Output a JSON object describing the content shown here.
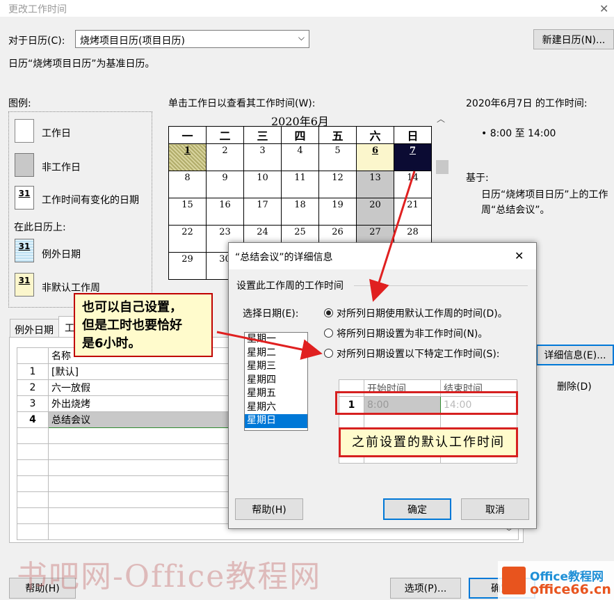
{
  "window": {
    "title": "更改工作时间",
    "close_glyph": "✕"
  },
  "calendar_selector": {
    "label": "对于日历(C):",
    "value": "烧烤项目日历(项目日历)",
    "base_text": "日历“烧烤项目日历”为基准日历。",
    "new_button": "新建日历(N)..."
  },
  "legend": {
    "title": "图例:",
    "items": [
      {
        "swatch": "",
        "label": "工作日"
      },
      {
        "swatch": "",
        "label": "非工作日"
      },
      {
        "swatch": "31",
        "label": "工作时间有变化的日期"
      }
    ],
    "on_calendar_title": "在此日历上:",
    "calendar_items": [
      {
        "swatch": "31",
        "label": "例外日期"
      },
      {
        "swatch": "31",
        "label": "非默认工作周"
      }
    ]
  },
  "month_view": {
    "instruction": "单击工作日以查看其工作时间(W):",
    "month": "2020年6月",
    "weekdays": [
      "一",
      "二",
      "三",
      "四",
      "五",
      "六",
      "日"
    ],
    "rows": [
      [
        "1",
        "2",
        "3",
        "4",
        "5",
        "6",
        "7"
      ],
      [
        "8",
        "9",
        "10",
        "11",
        "12",
        "13",
        "14"
      ],
      [
        "15",
        "16",
        "17",
        "18",
        "19",
        "20",
        "21"
      ],
      [
        "22",
        "23",
        "24",
        "25",
        "26",
        "27",
        "28"
      ],
      [
        "29",
        "30",
        "",
        "",
        "",
        "",
        ""
      ],
      [
        "",
        "",
        "",
        "",
        "",
        "",
        ""
      ]
    ]
  },
  "work_time": {
    "heading": "2020年6月7日 的工作时间:",
    "bullet": "• 8:00 至 14:00",
    "based_on_label": "基于:",
    "based_on_text_1": "日历“烧烤项目日历”上的工作",
    "based_on_text_2": "周“总结会议”。"
  },
  "tabs": {
    "exceptions": "例外日期",
    "workweeks": "工"
  },
  "week_table": {
    "header": [
      "",
      "名称"
    ],
    "rows": [
      {
        "idx": "1",
        "name": "[默认]"
      },
      {
        "idx": "2",
        "name": "六一放假"
      },
      {
        "idx": "3",
        "name": "外出烧烤"
      },
      {
        "idx": "4",
        "name": "总结会议"
      }
    ]
  },
  "side_buttons": {
    "details": "详细信息(E)...",
    "delete": "删除(D)"
  },
  "bottom_buttons": {
    "help": "帮助(H)",
    "options": "选项(P)...",
    "ok": "确定"
  },
  "dialog": {
    "title": "“总结会议”的详细信息",
    "close_glyph": "✕",
    "group_label": "设置此工作周的工作时间",
    "select_day_label": "选择日期(E):",
    "radios": [
      {
        "label": "对所列日期使用默认工作周的时间(D)。",
        "checked": true
      },
      {
        "label": "将所列日期设置为非工作时间(N)。",
        "checked": false
      },
      {
        "label": "对所列日期设置以下特定工作时间(S):",
        "checked": false
      }
    ],
    "days": [
      "星期一",
      "星期二",
      "星期三",
      "星期四",
      "星期五",
      "星期六",
      "星期日"
    ],
    "selected_day": "星期日",
    "time_table": {
      "col_start": "开始时间",
      "col_end": "结束时间",
      "row_idx": "1",
      "start": "8:00",
      "end": "14:00"
    },
    "help_button": "帮助(H)",
    "ok_button": "确定",
    "cancel_button": "取消"
  },
  "annotations": {
    "callout_text_1": "也可以自己设置，",
    "callout_text_2": "但是工时也要恰好",
    "callout_text_3": "是6小时。",
    "red_label": "之前设置的默认工作时间"
  },
  "watermark": {
    "text": "书吧网-Office教程网",
    "logo_text_1": "Office教程网",
    "logo_text_2": "office66.cn"
  },
  "colors": {
    "accent": "#0078d7",
    "annotation_red": "#d62020",
    "callout_bg": "#fffbcc"
  }
}
